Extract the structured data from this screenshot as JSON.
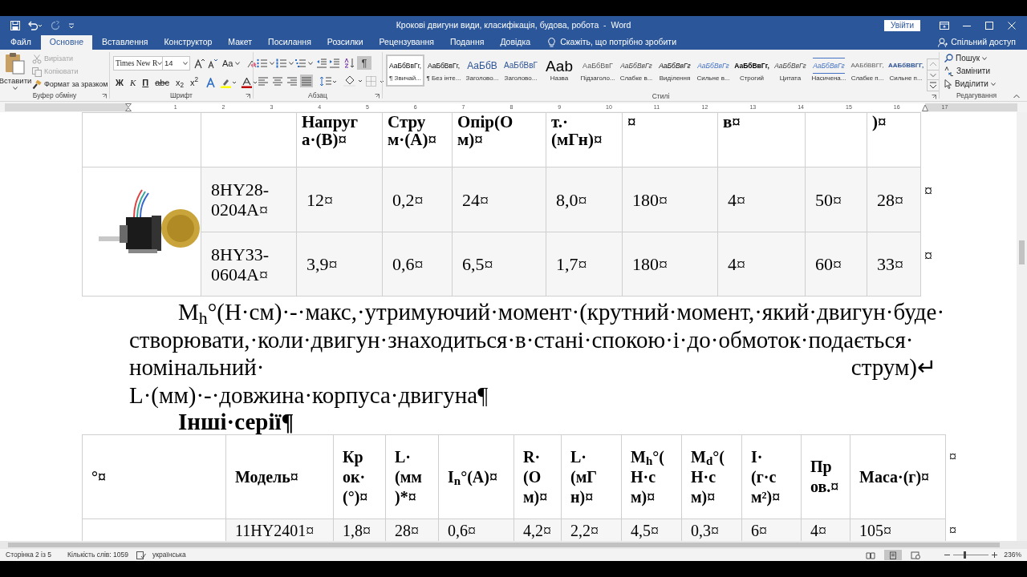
{
  "window": {
    "title": "Крокові двигуни види, класифікація, будова, робота  -  Word",
    "sign_in": "Увійти"
  },
  "tabs": [
    {
      "label": "Файл",
      "selected": false
    },
    {
      "label": "Основне",
      "selected": true
    },
    {
      "label": "Вставлення",
      "selected": false
    },
    {
      "label": "Конструктор",
      "selected": false
    },
    {
      "label": "Макет",
      "selected": false
    },
    {
      "label": "Посилання",
      "selected": false
    },
    {
      "label": "Розсилки",
      "selected": false
    },
    {
      "label": "Рецензування",
      "selected": false
    },
    {
      "label": "Подання",
      "selected": false
    },
    {
      "label": "Довідка",
      "selected": false
    }
  ],
  "tell_me": "Скажіть, що потрібно зробити",
  "share": "Спільний доступ",
  "clipboard": {
    "group": "Буфер обміну",
    "paste": "Вставити",
    "tools": [
      {
        "kind": "cut",
        "label": "Вирізати",
        "disabled": true
      },
      {
        "kind": "copy",
        "label": "Копіювати",
        "disabled": true
      },
      {
        "kind": "painter",
        "label": "Формат за зразком",
        "disabled": false
      }
    ]
  },
  "font": {
    "group": "Шрифт",
    "name": "Times New R",
    "size": "14",
    "case": "Aa",
    "format_buttons": [
      "Ж",
      "К",
      "П",
      "abc",
      "x$_{2}$",
      "x$^{2}$"
    ]
  },
  "paragraph": {
    "group": "Абзац",
    "show_marks": {
      "glyph": "¶",
      "selected": true
    },
    "alignments": [
      {
        "kind": "left",
        "selected": false
      },
      {
        "kind": "center",
        "selected": false
      },
      {
        "kind": "right",
        "selected": false
      },
      {
        "kind": "justify",
        "selected": true
      }
    ]
  },
  "styles": {
    "group": "Стилі",
    "items": [
      {
        "kind": "normal",
        "preview": "АаБбВвГг,",
        "name": "¶ Звичай...",
        "selected": true
      },
      {
        "kind": "no_spacing",
        "preview": "АаБбВвГг,",
        "name": "¶ Без інте...",
        "selected": false
      },
      {
        "kind": "heading_1",
        "preview": "АаБбВ",
        "name": "Заголово...",
        "selected": false
      },
      {
        "kind": "heading_2",
        "preview": "АаБбВвГ",
        "name": "Заголово...",
        "selected": false
      },
      {
        "kind": "title",
        "preview": "Ааb",
        "name": "Назва",
        "selected": false
      },
      {
        "kind": "subtitle",
        "preview": "АаБбВвГ",
        "name": "Підзаголо...",
        "selected": false
      },
      {
        "kind": "subtle_emphasis",
        "preview": "АаБбВвГг",
        "name": "Слабке в...",
        "selected": false
      },
      {
        "kind": "emphasis",
        "preview": "АаБбВвГг",
        "name": "Виділення",
        "selected": false
      },
      {
        "kind": "intense_emphasis",
        "preview": "АаБбВвГг",
        "name": "Сильне в...",
        "selected": false
      },
      {
        "kind": "strong",
        "preview": "АаБбВвГг,",
        "name": "Строгий",
        "selected": false
      },
      {
        "kind": "quote",
        "preview": "АаБбВвГг",
        "name": "Цитата",
        "selected": false
      },
      {
        "kind": "intense_quote",
        "preview": "АаБбВвГг",
        "name": "Насичена...",
        "selected": false
      },
      {
        "kind": "subtle_reference",
        "preview": "ААБбВВГГ,",
        "name": "Слабке п...",
        "selected": false
      },
      {
        "kind": "intense_reference",
        "preview": "ААБбВВГГ,",
        "name": "Сильне п...",
        "selected": false
      }
    ]
  },
  "editing": {
    "group": "Редагування",
    "find": "Пошук",
    "replace": "Замінити",
    "select": "Виділити"
  },
  "ruler": [
    "1",
    "2",
    "3",
    "4",
    "5",
    "6",
    "7",
    "8",
    "9",
    "10",
    "11",
    "12",
    "13",
    "14",
    "15",
    "16",
    "17"
  ],
  "table_1": {
    "header": [
      {
        "kind": "blank"
      },
      {
        "kind": "blank"
      },
      {
        "kind": "text",
        "text": "Напруг\nа·(В)¤"
      },
      {
        "kind": "text",
        "text": "Стру\nм·(А)¤"
      },
      {
        "kind": "text",
        "text": "Опір(О\nм)¤"
      },
      {
        "kind": "text",
        "text": "т.·\n(мГн)¤"
      },
      {
        "kind": "text",
        "text": "¤"
      },
      {
        "kind": "text",
        "text": "в¤"
      },
      {
        "kind": "blank"
      },
      {
        "kind": "text",
        "text": ")¤"
      }
    ],
    "rows": [
      {
        "cells": [
          "8HY28-0204A¤",
          "12¤",
          "0,2¤",
          "24¤",
          "8,0¤",
          "180¤",
          "4¤",
          "50¤",
          "28¤"
        ],
        "row_end": "¤"
      },
      {
        "cells": [
          "8HY33-0604A¤",
          "3,9¤",
          "0,6¤",
          "6,5¤",
          "1,7¤",
          "180¤",
          "4¤",
          "60¤",
          "33¤"
        ],
        "row_end": "¤"
      }
    ]
  },
  "paragraph_1": {
    "lines": [
      "M$_{h}$°(Н·см)·-·макс,·утримуючий·момент·(крутний·момент,·який·двигун·буде·",
      "створювати,·коли·двигун·знаходиться·в·стані·спокою·і·до·обмоток·подається·"
    ],
    "last_line": [
      "номінальний·",
      "струм)↵"
    ]
  },
  "paragraph_2": "L·(мм)·-·довжина·корпуса·двигуна¶",
  "heading": "Інші·серії¶",
  "table_2": {
    "header": [
      "°¤",
      "Модель¤",
      "Кр\nок·\n(°)¤",
      "L·\n(мм\n)*¤",
      "I$_{n}$°(А)¤",
      "R·\n(О\nм)¤",
      "L·\n(мГ\nн)¤",
      "M$_{h}$°(\nН·с\nм)¤",
      "M$_{d}$°(\nН·с\nм)¤",
      "I·\n(г·с\nм²)¤",
      "Пр\nов.¤",
      "Маса·(г)¤"
    ],
    "header_end": "¤",
    "rows": [
      {
        "cells": [
          "11HY2401¤",
          "1,8¤",
          "28¤",
          "0,6¤",
          "4,2¤",
          "2,2¤",
          "4,5¤",
          "0,3¤",
          "6¤",
          "4¤",
          "105¤"
        ],
        "row_end": "¤"
      }
    ]
  },
  "status_bar": {
    "page": "Сторінка 2 із 5",
    "words": "Кількість слів: 1059",
    "language": "українська",
    "views": [
      {
        "kind": "read",
        "selected": false
      },
      {
        "kind": "print",
        "selected": true
      },
      {
        "kind": "web",
        "selected": false
      }
    ],
    "zoom_slider": {
      "level": 0.3
    },
    "zoom": "236%"
  }
}
